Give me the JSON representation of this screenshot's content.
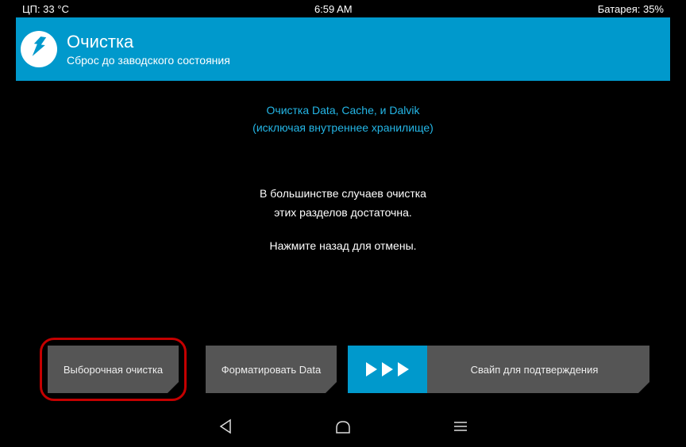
{
  "statusbar": {
    "cpu": "ЦП: 33 °С",
    "time": "6:59 AM",
    "battery": "Батарея: 35%"
  },
  "header": {
    "title": "Очистка",
    "subtitle": "Сброс до заводского состояния"
  },
  "info": {
    "line1": "Очистка Data, Cache, и Dalvik",
    "line2": "(исключая внутреннее хранилище)",
    "line3": "В большинстве случаев очистка",
    "line4": "этих разделов достаточна.",
    "line5": "Нажмите назад для отмены."
  },
  "buttons": {
    "advanced": "Выборочная очистка",
    "format": "Форматировать Data",
    "swipe": "Свайп для подтверждения"
  }
}
